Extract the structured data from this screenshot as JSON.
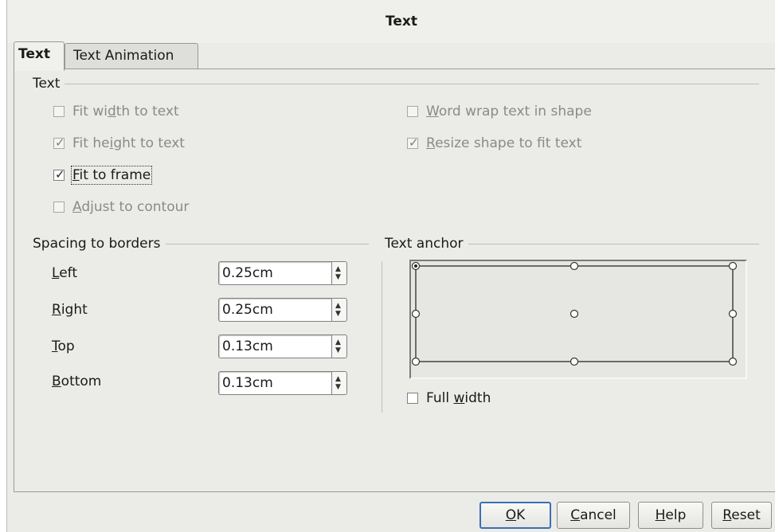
{
  "window": {
    "title": "Text"
  },
  "tabs": [
    {
      "label": "Text",
      "active": true
    },
    {
      "label": "Text Animation",
      "active": false
    }
  ],
  "text_section": {
    "heading": "Text",
    "options": {
      "fit_width": {
        "pre": "Fit wi",
        "key": "d",
        "post": "th to text",
        "checked": false,
        "enabled": false
      },
      "fit_height": {
        "pre": "Fit he",
        "key": "i",
        "post": "ght to text",
        "checked": true,
        "enabled": false
      },
      "fit_frame": {
        "pre": "",
        "key": "F",
        "post": "it to frame",
        "checked": true,
        "enabled": true
      },
      "adjust_contour": {
        "pre": "",
        "key": "A",
        "post": "djust to contour",
        "checked": false,
        "enabled": false
      },
      "word_wrap": {
        "pre": "",
        "key": "W",
        "post": "ord wrap text in shape",
        "checked": false,
        "enabled": false
      },
      "resize_shape": {
        "pre": "",
        "key": "R",
        "post": "esize shape to fit text",
        "checked": true,
        "enabled": false
      }
    }
  },
  "spacing": {
    "heading": "Spacing to borders",
    "fields": [
      {
        "key": "L",
        "rest": "eft",
        "value": "0.25cm"
      },
      {
        "key": "R",
        "rest": "ight",
        "value": "0.25cm"
      },
      {
        "key": "T",
        "rest": "op",
        "value": "0.13cm"
      },
      {
        "key": "B",
        "rest": "ottom",
        "value": "0.13cm"
      }
    ]
  },
  "anchor": {
    "heading": "Text anchor",
    "selected": "top-left",
    "full_width": {
      "pre": "Full ",
      "key": "w",
      "post": "idth",
      "checked": false
    }
  },
  "buttons": {
    "ok": {
      "key": "O",
      "rest": "K"
    },
    "cancel": {
      "key": "C",
      "rest": "ancel"
    },
    "help": {
      "key": "H",
      "rest": "elp"
    },
    "reset": {
      "key": "R",
      "rest": "eset"
    }
  },
  "icons": {
    "check": "✓",
    "spin_up": "▲",
    "spin_down": "▼"
  }
}
